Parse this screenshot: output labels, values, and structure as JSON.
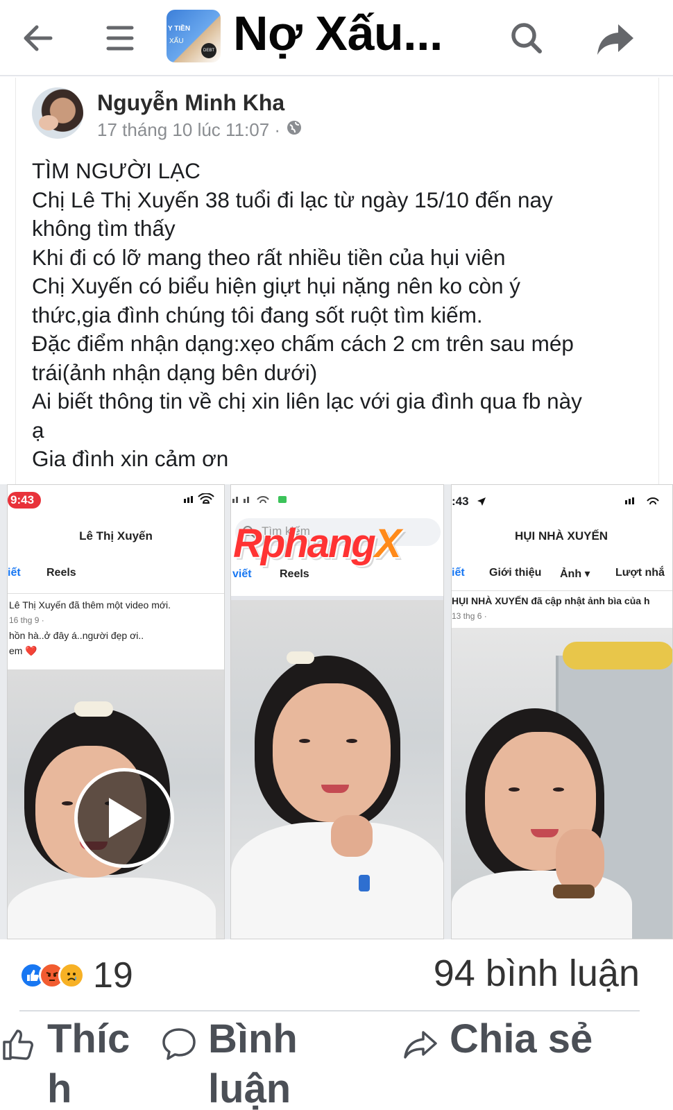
{
  "header": {
    "group_title": "Nợ Xấu...",
    "logo": {
      "line1": "Y TIỀN",
      "line2": "XẤU",
      "badge": "DEBT"
    },
    "icons": [
      "back-arrow-icon",
      "menu-icon",
      "search-icon",
      "share-forward-icon"
    ]
  },
  "post": {
    "author": "Nguyễn Minh Kha",
    "timestamp": "17 tháng 10 lúc 11:07 ·",
    "privacy_icon": "globe-icon",
    "lines": [
      "TÌM NGƯỜI LẠC",
      "Chị Lê Thị Xuyến 38 tuổi đi lạc từ ngày 15/10 đến nay",
      "không tìm thấy",
      "Khi đi có lỡ mang theo rất nhiều tiền của hụi viên",
      "Chị Xuyến có biểu hiện giựt hụi nặng nên ko còn ý",
      "thức,gia đình chúng tôi đang sốt ruột tìm kiếm.",
      "Đặc điểm nhận dạng:xẹo chấm cách 2 cm trên sau mép",
      "trái(ảnh nhận dạng bên dưới)",
      "Ai biết thông tin về chị xin liên lạc với gia đình qua fb này",
      "ạ",
      "Gia đình xin cảm ơn"
    ]
  },
  "screenshots": {
    "left": {
      "time": "9:43",
      "title": "Lê Thị Xuyến",
      "tab1": "iết",
      "tab2": "Reels",
      "feed_line1": "Lê Thị Xuyến đã thêm một video mới.",
      "feed_date": "16 thg 9 ·",
      "feed_line2": "hồn hà..ở đây á..người đẹp ơi..",
      "feed_line3": "em ❤️"
    },
    "middle": {
      "search_placeholder": "Tìm kiếm",
      "tab1": "viết",
      "tab2": "Reels"
    },
    "right": {
      "time": ":43",
      "title": "HỤI NHÀ XUYẾN",
      "tab1": "iết",
      "tab2": "Giới thiệu",
      "tab3": "Ảnh ▾",
      "tab4": "Lượt nhắ",
      "feed_line1": "HỤI NHÀ XUYẾN đã cập nhật ảnh bìa của h",
      "feed_date": "13 thg 6 ·"
    },
    "watermark_main": "Rphang",
    "watermark_x": "X"
  },
  "stats": {
    "reaction_count": "19",
    "comment_count": "94 bình luận"
  },
  "actions": {
    "like": "Thích",
    "comment": "Bình luận",
    "share": "Chia sẻ"
  },
  "colors": {
    "like_blue": "#1877f2",
    "angry_orange": "#f25c30",
    "sad_yellow": "#f7b125",
    "watermark_red": "#ff3333",
    "watermark_orange": "#ff8a1a",
    "muted_text": "#8a8d91"
  }
}
